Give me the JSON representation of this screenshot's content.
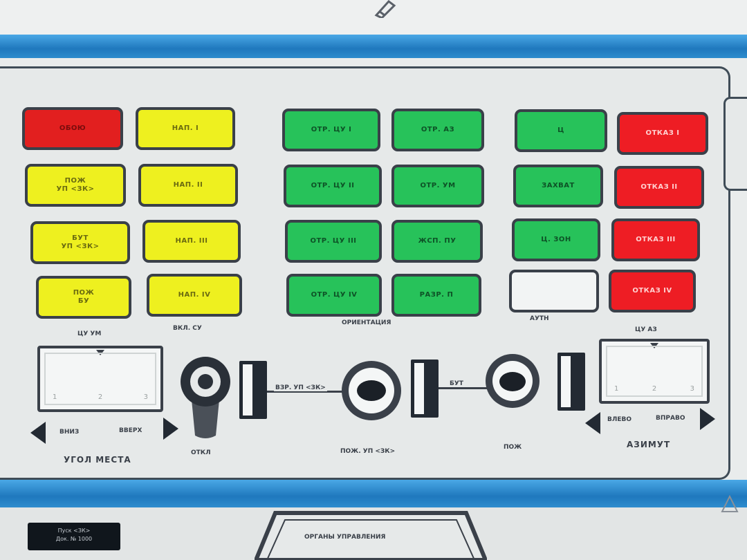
{
  "colors": {
    "panel_bg": "#e6e9e9",
    "red_lamp": "#e21f1f",
    "yellow_lamp": "#eef01f",
    "green_lamp": "#27c25a",
    "alarm_lamp": "#ee1d24",
    "blue_bar": "#2f8fd0"
  },
  "lamps": {
    "col1": [
      "ОБОЮ",
      "ПОЖ\nУП <ЗК>",
      "БУТ\nУП <ЗК>",
      "ПОЖ\nБУ"
    ],
    "col2": [
      "НАП. I",
      "НАП. II",
      "НАП. III",
      "НАП. IV"
    ],
    "col3": [
      "ОТР. ЦУ I",
      "ОТР. ЦУ II",
      "ОТР. ЦУ III",
      "ОТР. ЦУ IV"
    ],
    "col4": [
      "ОТР. АЗ",
      "ОТР. УМ",
      "ЖСП. ПУ",
      "РАЗР. П"
    ],
    "col5": [
      "Ц",
      "ЗАХВАТ",
      "Ц. ЗОН",
      ""
    ],
    "col6": [
      "ОТКАЗ I",
      "ОТКАЗ II",
      "ОТКАЗ III",
      "ОТКАЗ IV"
    ]
  },
  "group_labels": {
    "g1": "ЦУ УМ",
    "g2": "ВКЛ. СУ",
    "g3": "ОРИЕНТАЦИЯ",
    "g4": "АУТН",
    "g5": "ЦУ АЗ"
  },
  "left_gauge": {
    "scale": [
      "1",
      "2",
      "3"
    ],
    "left_label": "ВНИЗ",
    "right_label": "ВВЕРХ",
    "caption": "УГОЛ МЕСТА"
  },
  "right_gauge": {
    "scale": [
      "1",
      "2",
      "3"
    ],
    "left_label": "ВЛЕВО",
    "right_label": "ВПРАВО",
    "caption": "АЗИМУТ"
  },
  "controls": {
    "toggle_label": "ОТКЛ",
    "link_label_1": "ВЗР. УП <ЗК>",
    "button1_label": "ПОЖ. УП <ЗК>",
    "link_label_2": "БУТ",
    "button2_label": "ПОЖ"
  },
  "bottom": {
    "plate_line1": "Пуск <ЗК>",
    "plate_line2": "Док. № 1000",
    "center_title": "ОРГАНЫ УПРАВЛЕНИЯ"
  }
}
